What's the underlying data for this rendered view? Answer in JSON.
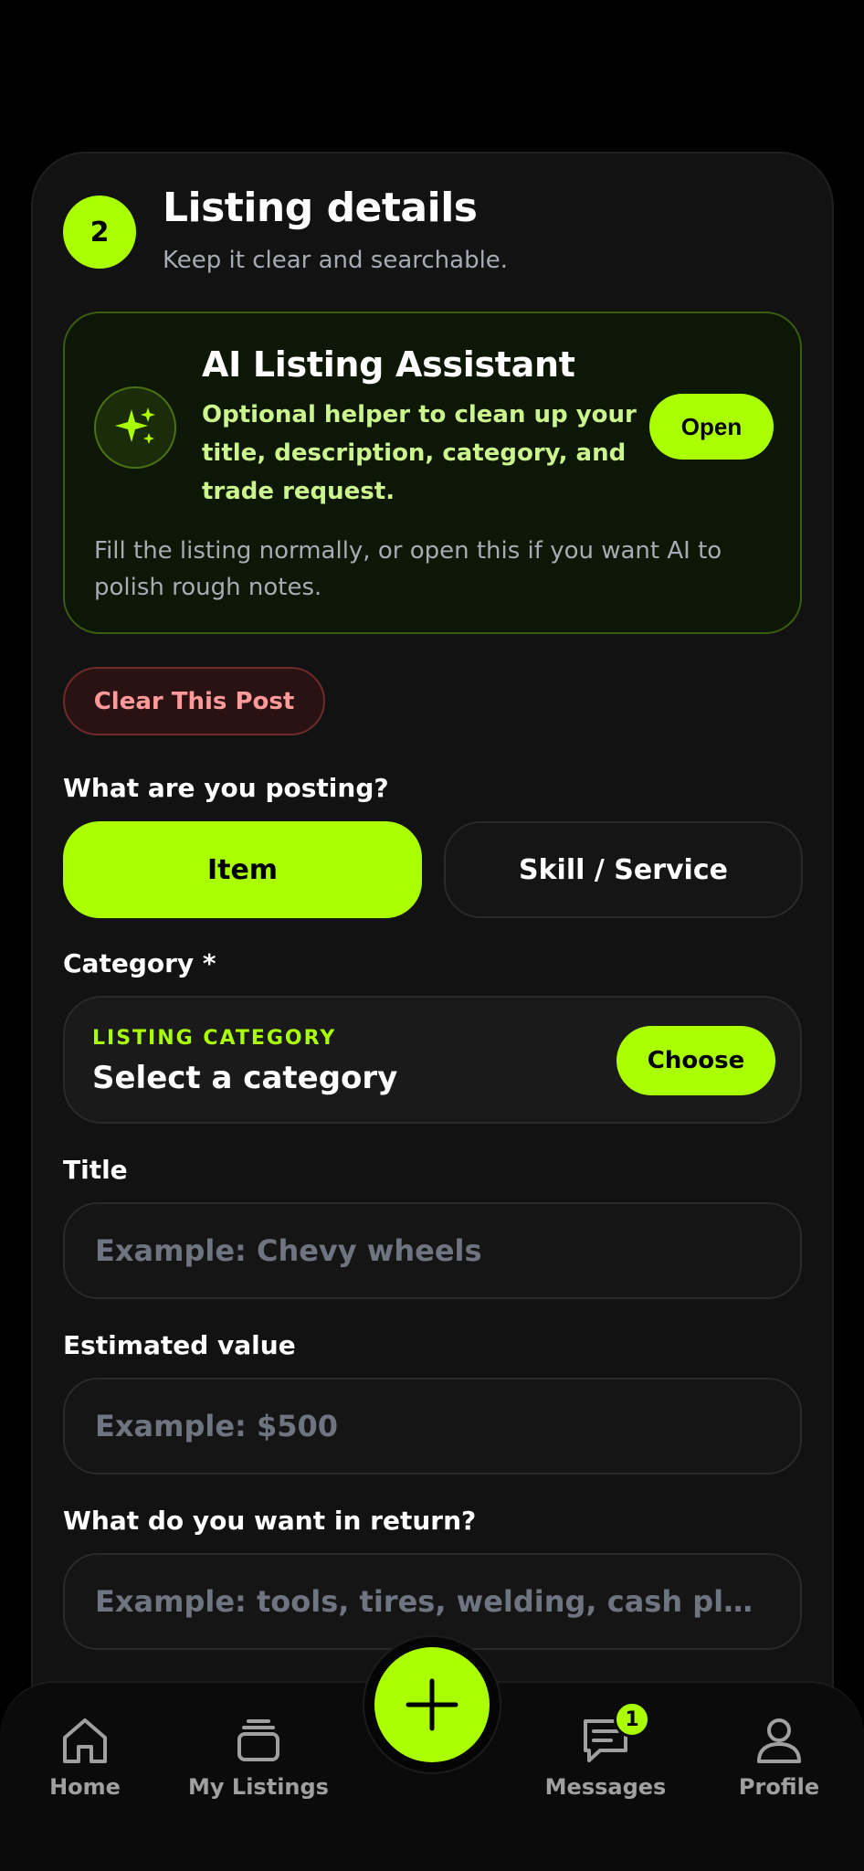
{
  "step": {
    "number": "2",
    "title": "Listing details",
    "subtitle": "Keep it clear and searchable."
  },
  "ai_assistant": {
    "icon": "sparkles-icon",
    "title": "AI Listing Assistant",
    "description": "Optional helper to clean up your title, description, category, and trade request.",
    "open_label": "Open",
    "note": "Fill the listing normally, or open this if you want AI to polish rough notes."
  },
  "clear_label": "Clear This Post",
  "posting_type": {
    "label": "What are you posting?",
    "options": [
      "Item",
      "Skill / Service"
    ],
    "selected": "Item"
  },
  "category": {
    "label": "Category *",
    "eyebrow": "LISTING CATEGORY",
    "value": "Select a category",
    "choose_label": "Choose"
  },
  "title_field": {
    "label": "Title",
    "placeholder": "Example: Chevy wheels"
  },
  "value_field": {
    "label": "Estimated value",
    "placeholder": "Example: $500"
  },
  "return_field": {
    "label": "What do you want in return?",
    "placeholder": "Example: tools, tires, welding, cash plu..."
  },
  "nav": {
    "items": [
      {
        "label": "Home",
        "icon": "home-icon"
      },
      {
        "label": "My Listings",
        "icon": "listings-stack-icon"
      },
      {
        "label": "Messages",
        "icon": "message-icon",
        "badge": "1"
      },
      {
        "label": "Profile",
        "icon": "profile-icon"
      }
    ],
    "fab_icon": "plus-icon"
  },
  "colors": {
    "accent": "#aaff00",
    "background": "#000000",
    "card": "#121212",
    "danger": "#ff9a9a"
  }
}
